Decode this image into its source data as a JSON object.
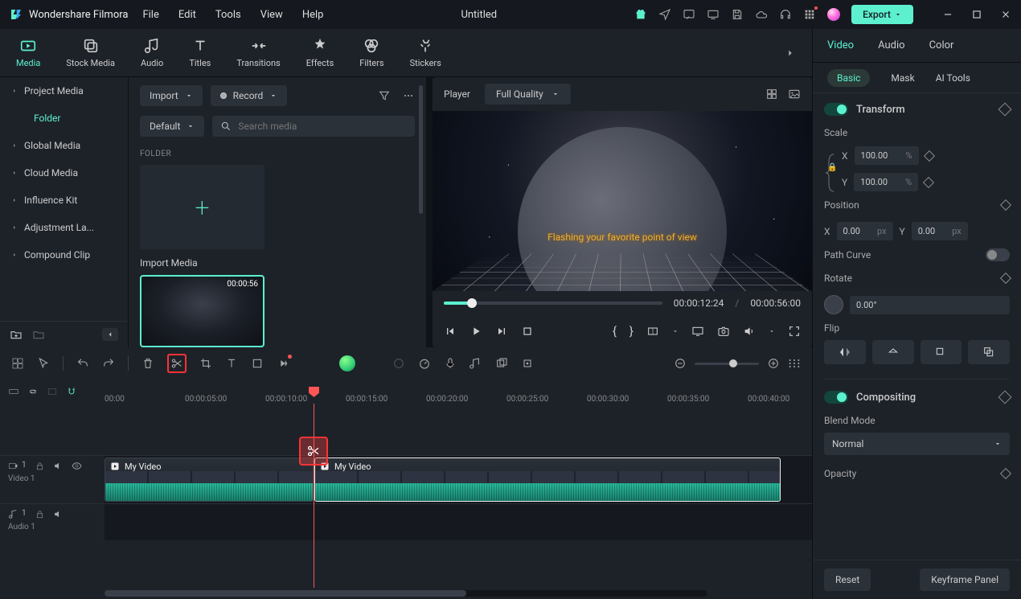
{
  "app_name": "Wondershare Filmora",
  "menus": [
    "File",
    "Edit",
    "Tools",
    "View",
    "Help"
  ],
  "doc_title": "Untitled",
  "export_label": "Export",
  "ribbon": [
    {
      "label": "Media",
      "active": true
    },
    {
      "label": "Stock Media"
    },
    {
      "label": "Audio"
    },
    {
      "label": "Titles"
    },
    {
      "label": "Transitions"
    },
    {
      "label": "Effects"
    },
    {
      "label": "Filters"
    },
    {
      "label": "Stickers"
    }
  ],
  "sidebar": {
    "items": [
      {
        "label": "Project Media"
      },
      {
        "label": "Folder",
        "active": true,
        "noChev": true
      },
      {
        "label": "Global Media"
      },
      {
        "label": "Cloud Media"
      },
      {
        "label": "Influence Kit"
      },
      {
        "label": "Adjustment La..."
      },
      {
        "label": "Compound Clip"
      }
    ]
  },
  "media": {
    "import_btn": "Import",
    "record_btn": "Record",
    "sort": "Default",
    "search_placeholder": "Search media",
    "section": "FOLDER",
    "import_media": "Import Media",
    "clip_duration": "00:00:56"
  },
  "player": {
    "label": "Player",
    "quality": "Full Quality",
    "caption": "Flashing your favorite point of view",
    "current": "00:00:12:24",
    "total": "00:00:56:00",
    "sep": "/"
  },
  "inspector": {
    "tabs": [
      "Video",
      "Audio",
      "Color"
    ],
    "subtabs": [
      "Basic",
      "Mask",
      "AI Tools"
    ],
    "transform": "Transform",
    "scale": "Scale",
    "scale_x": "100.00",
    "scale_y": "100.00",
    "percent": "%",
    "position": "Position",
    "pos_x": "0.00",
    "pos_y": "0.00",
    "px": "px",
    "path_curve": "Path Curve",
    "rotate": "Rotate",
    "rotate_val": "0.00°",
    "flip": "Flip",
    "compositing": "Compositing",
    "blend_mode": "Blend Mode",
    "blend_val": "Normal",
    "opacity": "Opacity",
    "reset": "Reset",
    "kf_panel": "Keyframe Panel",
    "X": "X",
    "Y": "Y"
  },
  "timeline": {
    "ruler": [
      "00:00",
      "00:00:05:00",
      "00:00:10:00",
      "00:00:15:00",
      "00:00:20:00",
      "00:00:25:00",
      "00:00:30:00",
      "00:00:35:00",
      "00:00:40:00"
    ],
    "video_track": "Video 1",
    "audio_track": "Audio 1",
    "clip1_name": "My Video",
    "clip2_name": "My Video"
  }
}
